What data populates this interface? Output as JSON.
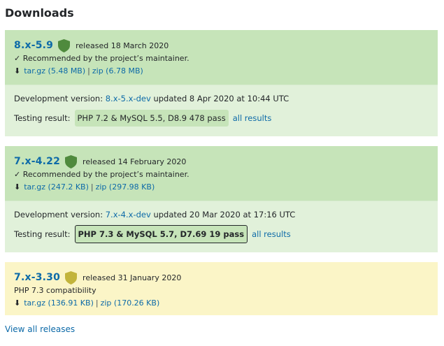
{
  "page": {
    "title": "Downloads",
    "view_all": "View all releases"
  },
  "colors": {
    "link": "#0d6aa8",
    "green": "#c6e4b9",
    "green_light": "#e1f1da",
    "yellow": "#fbf5c7",
    "shield_green": "#4f8a3d",
    "shield_yellow": "#c2b43c"
  },
  "releases": [
    {
      "version": "8.x-5.9",
      "released": "released 18 March 2020",
      "note": "✓ Recommended by the project’s maintainer.",
      "tar": "tar.gz (5.48 MB)",
      "zip": "zip (6.78 MB)",
      "dev_label": "Development version:",
      "dev_version": "8.x-5.x-dev",
      "dev_updated": "updated 8 Apr 2020 at 10:44 UTC",
      "test_label": "Testing result:",
      "test_result": "PHP 7.2 & MySQL 5.5, D8.9 478 pass",
      "all_results": "all results"
    },
    {
      "version": "7.x-4.22",
      "released": "released 14 February 2020",
      "note": "✓ Recommended by the project’s maintainer.",
      "tar": "tar.gz (247.2 KB)",
      "zip": "zip (297.98 KB)",
      "dev_label": "Development version:",
      "dev_version": "7.x-4.x-dev",
      "dev_updated": "updated 20 Mar 2020 at 17:16 UTC",
      "test_label": "Testing result:",
      "test_result": "PHP 7.3 & MySQL 5.7, D7.69 19 pass",
      "all_results": "all results"
    },
    {
      "version": "7.x-3.30",
      "released": "released 31 January 2020",
      "note": "PHP 7.3 compatibility",
      "tar": "tar.gz (136.91 KB)",
      "zip": "zip (170.26 KB)"
    }
  ],
  "icons": {
    "shield": "shield-icon",
    "download": "download-icon"
  }
}
